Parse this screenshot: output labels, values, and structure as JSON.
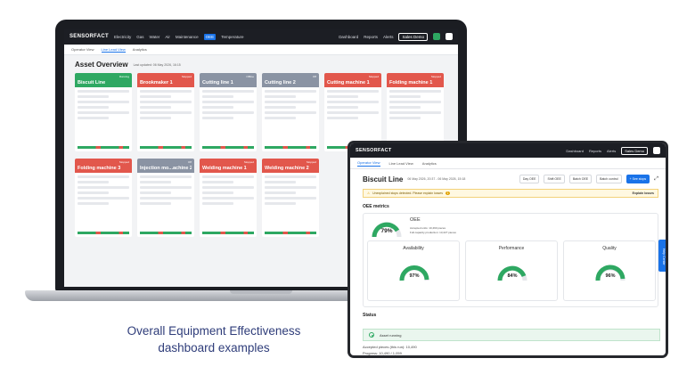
{
  "laptop": {
    "brand": "SENSORFACT",
    "nav": [
      "Electricity",
      "Gas",
      "Water",
      "Air",
      "Maintenance",
      "OEE",
      "Temperature"
    ],
    "right_links": [
      "Dashboard",
      "Reports",
      "Alerts"
    ],
    "org": "Sales Demo",
    "tabs": [
      "Operator View",
      "Line Lead View",
      "Analytics"
    ],
    "title": "Asset Overview",
    "updated": "Last updated: 06 May 2026, 16:15",
    "cards": [
      {
        "name": "Biscuit Line",
        "status": "Running",
        "color": "#2ea862"
      },
      {
        "name": "Brookmaker 1",
        "status": "Stopped",
        "color": "#e2574c"
      },
      {
        "name": "Cutting line 1",
        "status": "Offline",
        "color": "#8a93a3"
      },
      {
        "name": "Cutting line 2",
        "status": "Off",
        "color": "#8a93a3"
      },
      {
        "name": "Cutting machine 1",
        "status": "Stopped",
        "color": "#e2574c"
      },
      {
        "name": "Folding machine 1",
        "status": "Stopped",
        "color": "#e2574c"
      },
      {
        "name": "Folding machine 3",
        "status": "Stopped",
        "color": "#e2574c"
      },
      {
        "name": "Injection mo...achine 2",
        "status": "Off",
        "color": "#8a93a3"
      },
      {
        "name": "Welding machine 1",
        "status": "Stopped",
        "color": "#e2574c"
      },
      {
        "name": "Welding machine 2",
        "status": "Stopped",
        "color": "#e2574c"
      }
    ]
  },
  "caption": {
    "line1": "Overall Equipment Effectiveness",
    "line2": "dashboard examples"
  },
  "phone": {
    "brand": "SENSORFACT",
    "right_links": [
      "Dashboard",
      "Reports",
      "Alerts"
    ],
    "org": "Sales Demo",
    "tabs": [
      "Operator View",
      "Line Lead View",
      "Analytics"
    ],
    "asset": "Biscuit Line",
    "dates": "06 May 2026, 20:37 - 06 May 2026, 15:18",
    "buttons": [
      "Day OEE",
      "Shift OEE",
      "Batch OEE",
      "Batch control"
    ],
    "stop_btn": "+ See stops",
    "warning": "Unexplained stops detected. Please explain losses",
    "warning_count": "1",
    "explain": "Explain losses",
    "oee_section": "OEE metrics",
    "oee_label": "OEE",
    "oee_value": "79%",
    "accepted_units": "Accepted units: 10,490 pieces",
    "capacity": "Full capacity production: 13,227 pieces",
    "metrics": [
      {
        "label": "Availability",
        "value": "97%"
      },
      {
        "label": "Performance",
        "value": "84%"
      },
      {
        "label": "Quality",
        "value": "96%"
      }
    ],
    "status_section": "Status",
    "status_text": "Asset running",
    "accepted_run": "Accepted pieces (this run): 10,490",
    "progress": "Progress: 10,490 / 1,059",
    "help": "Help Center"
  }
}
